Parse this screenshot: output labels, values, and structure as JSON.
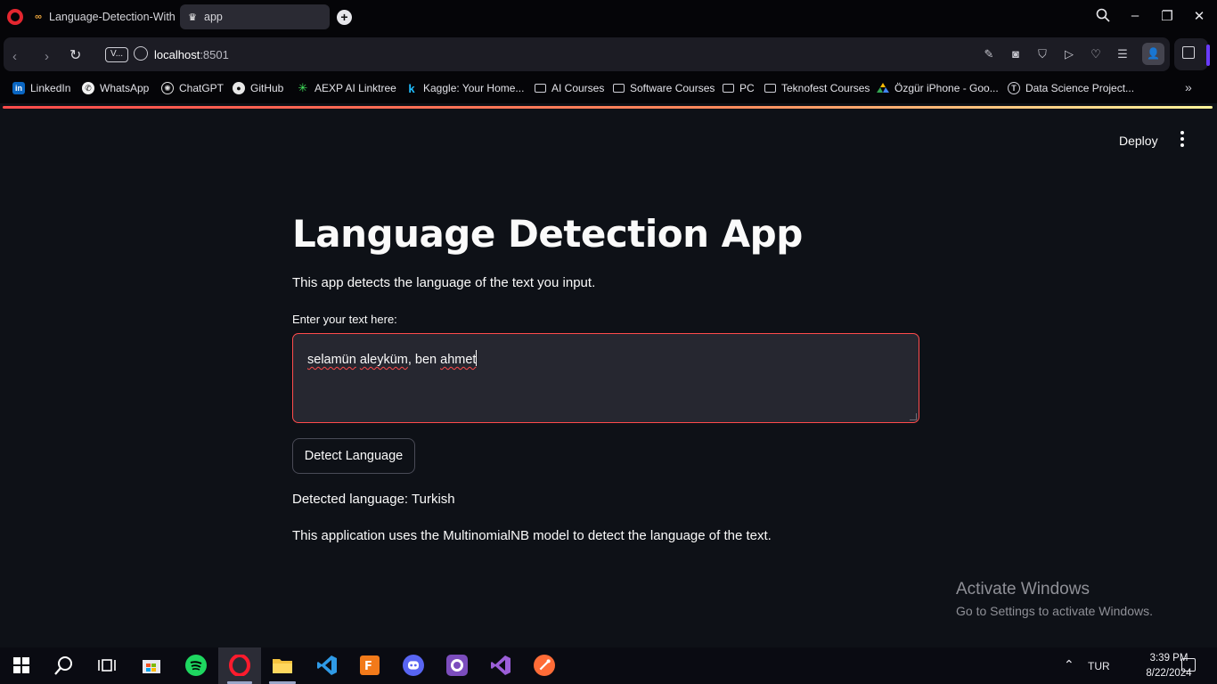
{
  "browser": {
    "tabs": [
      {
        "label": "Language-Detection-With"
      },
      {
        "label": "app"
      }
    ],
    "address": {
      "host": "localhost",
      "port": ":8501",
      "badge": "V..."
    },
    "bookmarks": [
      {
        "label": "LinkedIn",
        "icon": "linkedin-icon"
      },
      {
        "label": "WhatsApp",
        "icon": "whatsapp-icon"
      },
      {
        "label": "ChatGPT",
        "icon": "chatgpt-icon"
      },
      {
        "label": "GitHub",
        "icon": "github-icon"
      },
      {
        "label": "AEXP AI Linktree",
        "icon": "linktree-icon"
      },
      {
        "label": "Kaggle: Your Home...",
        "icon": "kaggle-icon"
      },
      {
        "label": "AI Courses",
        "icon": "folder-icon"
      },
      {
        "label": "Software Courses",
        "icon": "folder-icon"
      },
      {
        "label": "PC",
        "icon": "folder-icon"
      },
      {
        "label": "Teknofest Courses",
        "icon": "folder-icon"
      },
      {
        "label": "Özgür iPhone - Goo...",
        "icon": "google-drive-icon"
      },
      {
        "label": "Data Science Project...",
        "icon": "site-icon"
      }
    ]
  },
  "app": {
    "toolbar": {
      "deploy_label": "Deploy"
    },
    "title": "Language Detection App",
    "description": "This app detects the language of the text you input.",
    "input": {
      "label": "Enter your text here:",
      "value_words": [
        {
          "text": "selamün",
          "misspelled": true
        },
        {
          "text": " "
        },
        {
          "text": "aleyküm",
          "misspelled": true
        },
        {
          "text": ", ben "
        },
        {
          "text": "ahmet",
          "misspelled": true
        }
      ]
    },
    "button_label": "Detect Language",
    "result": "Detected language: Turkish",
    "note": "This application uses the MultinomialNB model to detect the language of the text."
  },
  "watermark": {
    "line1": "Activate Windows",
    "line2": "Go to Settings to activate Windows."
  },
  "taskbar": {
    "apps": [
      "start-icon",
      "search-icon",
      "task-view-icon",
      "store-icon",
      "spotify-icon",
      "opera-icon",
      "file-explorer-icon",
      "vscode-icon",
      "fl-studio-icon",
      "discord-icon",
      "github-desktop-icon",
      "visual-studio-icon",
      "postman-icon"
    ],
    "language": "TUR",
    "time": "3:39 PM",
    "date": "8/22/2024"
  },
  "colors": {
    "app_background": "#0e1117",
    "input_background": "#262730",
    "focus_border": "#ff4b4b",
    "text": "#fafafa"
  }
}
